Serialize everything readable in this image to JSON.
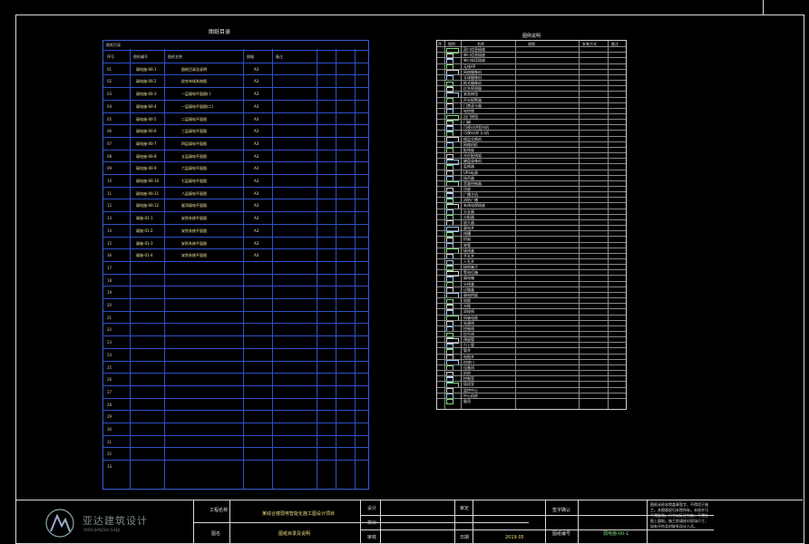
{
  "drawing_index": {
    "title": "图纸目录",
    "subheader": "图纸目录",
    "headers": [
      "序号",
      "图纸编号",
      "图纸名称",
      "图幅",
      "备注",
      "",
      ""
    ],
    "rows": [
      {
        "n": "01",
        "code": "弱电施-00-1",
        "name": "图纸目录及说明",
        "size": "A3"
      },
      {
        "n": "02",
        "code": "弱电施-00-2",
        "name": "综合布线系统图",
        "size": "A3"
      },
      {
        "n": "03",
        "code": "弱电施-00-3",
        "name": "一层弱电平面图(-)",
        "size": "A3"
      },
      {
        "n": "04",
        "code": "弱电施-00-4",
        "name": "一层弱电平面图(二)",
        "size": "A3"
      },
      {
        "n": "05",
        "code": "弱电施-00-5",
        "name": "二层弱电平面图",
        "size": "A3"
      },
      {
        "n": "06",
        "code": "弱电施-00-6",
        "name": "三层弱电平面图",
        "size": "A3"
      },
      {
        "n": "07",
        "code": "弱电施-00-7",
        "name": "四层弱电平面图",
        "size": "A3"
      },
      {
        "n": "08",
        "code": "弱电施-00-8",
        "name": "五层弱电平面图",
        "size": "A3"
      },
      {
        "n": "09",
        "code": "弱电施-00-9",
        "name": "六层弱电平面图",
        "size": "A3"
      },
      {
        "n": "10",
        "code": "弱电施-00-10",
        "name": "七层弱电平面图",
        "size": "A3"
      },
      {
        "n": "11",
        "code": "弱电施-00-11",
        "name": "八层弱电平面图",
        "size": "A3"
      },
      {
        "n": "12",
        "code": "弱电施-00-12",
        "name": "屋顶弱电平面图",
        "size": "A3"
      },
      {
        "n": "13",
        "code": "弱施-01-1",
        "name": "安防系统平面图",
        "size": "A3"
      },
      {
        "n": "14",
        "code": "弱施-01-2",
        "name": "安防系统平面图",
        "size": "A3"
      },
      {
        "n": "15",
        "code": "弱施-01-3",
        "name": "安防系统平面图",
        "size": "A3"
      },
      {
        "n": "16",
        "code": "弱施-01-4",
        "name": "安防系统平面图",
        "size": "A3"
      }
    ],
    "empty_numbers": [
      "17",
      "18",
      "19",
      "20",
      "21",
      "22",
      "23",
      "24",
      "25",
      "26",
      "27",
      "28",
      "29",
      "30",
      "31",
      "32",
      "33"
    ]
  },
  "legend": {
    "title": "图例说明",
    "headers": [
      "序",
      "图例",
      "名称",
      "规格",
      "安装方式",
      "备注"
    ],
    "rows": [
      "双口信息插座",
      "单口信息插座",
      "单口电话插座",
      "无线AP",
      "网络摄像机",
      "半球摄像机",
      "枪式摄像机",
      "红外探测器",
      "紧急按钮",
      "声光报警器",
      "门禁读卡器",
      "电控锁",
      "出门按钮",
      "门磁",
      "可视对讲室内机",
      "可视对讲门口机",
      "楼层交换机",
      "网络机柜",
      "配线架",
      "光纤配线架",
      "硬盘录像机",
      "监视器",
      "UPS电源",
      "扬声器",
      "音量控制器",
      "功放",
      "广播主机",
      "消防广播",
      "有线电视插座",
      "分支器",
      "分配器",
      "放大器",
      "弱电井",
      "线槽",
      "桥架",
      "穿管",
      "接线盒",
      "手孔井",
      "人孔井",
      "接地端子",
      "等电位箱",
      "弱电箱",
      "分线盒",
      "过路盒",
      "弱电桥架",
      "电缆",
      "光缆",
      "双绞线",
      "同轴电缆",
      "电源线",
      "控制线",
      "信号线",
      "预留管",
      "引上管",
      "管井",
      "电缆井",
      "检修口",
      "设备间",
      "机房",
      "控制室",
      "值班室",
      "监控中心",
      "中心机房",
      "备用"
    ]
  },
  "title_block": {
    "company": "亚达建筑设计",
    "company_sub": "YADA JIANZHU SHEJI",
    "project_label": "工程名称",
    "project_value": "某综合楼弱电智能化施工图设计项目",
    "drawing_label": "图名",
    "drawing_value": "图纸目录及说明",
    "design_label": "设计",
    "check_label": "校对",
    "review_label": "审核",
    "approve_label": "审定",
    "date_label": "日期",
    "date_value": "2019.05",
    "seal_label": "签字确认",
    "number_label": "图纸编号",
    "number_value": "弱电施-00-1",
    "notes": "图纸未经本院盖章签字，不得用于施工。本图版权归本院所有，未经许可不得复制。尺寸以标注为准，不得在图上量取。施工前请核对现场尺寸，如有不符及时联系设计人员。"
  }
}
